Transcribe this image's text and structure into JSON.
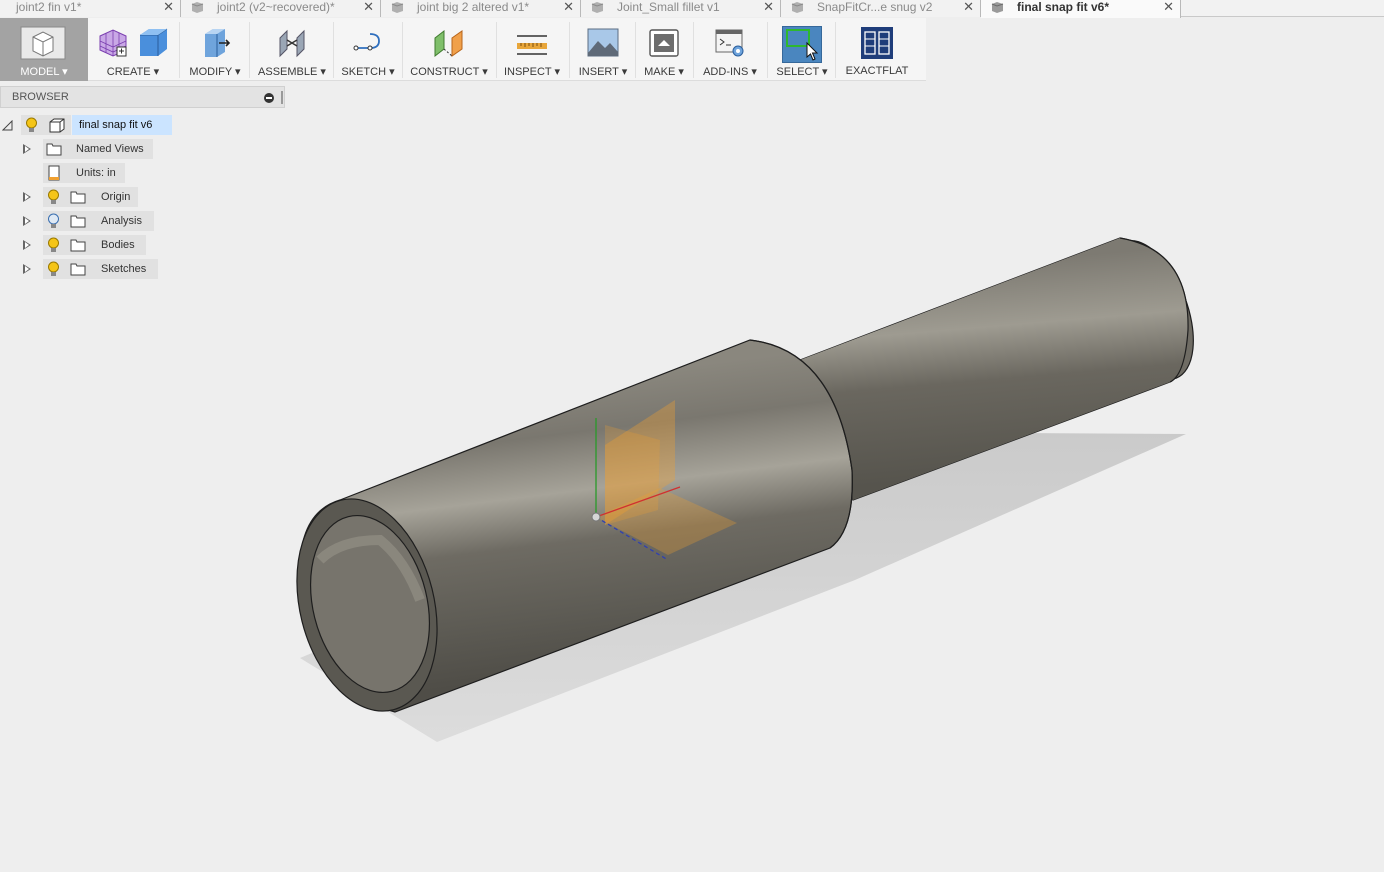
{
  "tabs": [
    {
      "label": "joint2 fin v1*",
      "active": false
    },
    {
      "label": "joint2 (v2~recovered)*",
      "active": false
    },
    {
      "label": "joint big 2 altered v1*",
      "active": false
    },
    {
      "label": "Joint_Small fillet v1",
      "active": false
    },
    {
      "label": "SnapFitCr...e snug v2",
      "active": false
    },
    {
      "label": "final snap fit v6*",
      "active": true
    }
  ],
  "toolbar": {
    "model": "MODEL ▾",
    "create": "CREATE ▾",
    "modify": "MODIFY ▾",
    "assemble": "ASSEMBLE ▾",
    "sketch": "SKETCH ▾",
    "construct": "CONSTRUCT ▾",
    "inspect": "INSPECT ▾",
    "insert": "INSERT ▾",
    "make": "MAKE ▾",
    "addins": "ADD-INS ▾",
    "select": "SELECT ▾",
    "exactflat": "EXACTFLAT"
  },
  "browser": {
    "title": "BROWSER",
    "root": "final snap fit v6",
    "items": [
      {
        "label": "Named Views"
      },
      {
        "label": "Units: in"
      },
      {
        "label": "Origin"
      },
      {
        "label": "Analysis"
      },
      {
        "label": "Bodies"
      },
      {
        "label": "Sketches"
      }
    ]
  },
  "colors": {
    "accent": "#3a7fc8",
    "select_active": "#4a86bf",
    "body_gray": "#6f6d66",
    "root_highlight": "#cbe4ff",
    "bulb": "#f5c518"
  },
  "icons": [
    "tab-document-icon",
    "tab-close-icon",
    "model-workspace-icon",
    "create-sketch-grid-icon",
    "box-icon",
    "press-pull-icon",
    "joint-icon",
    "sketch-line-icon",
    "offset-plane-icon",
    "measure-icon",
    "canvas-image-icon",
    "print-3d-icon",
    "scripts-icon",
    "select-window-icon",
    "exactflat-icon",
    "lightbulb-icon",
    "folder-icon",
    "units-doc-icon",
    "collapse-icon"
  ]
}
